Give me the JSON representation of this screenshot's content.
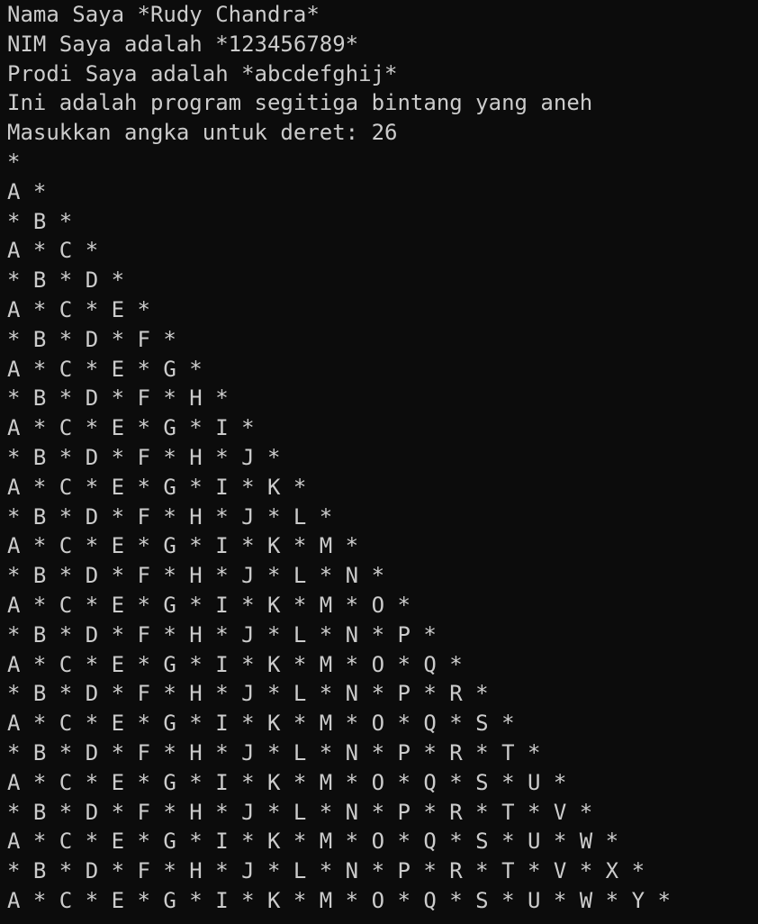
{
  "terminal": {
    "intro": [
      "Nama Saya *Rudy Chandra*",
      "NIM Saya adalah *123456789*",
      "Prodi Saya adalah *abcdefghij*",
      "Ini adalah program segitiga bintang yang aneh",
      "Masukkan angka untuk deret: 26"
    ],
    "triangle": [
      "*",
      "A *",
      "* B *",
      "A * C *",
      "* B * D *",
      "A * C * E *",
      "* B * D * F *",
      "A * C * E * G *",
      "* B * D * F * H *",
      "A * C * E * G * I *",
      "* B * D * F * H * J *",
      "A * C * E * G * I * K *",
      "* B * D * F * H * J * L *",
      "A * C * E * G * I * K * M *",
      "* B * D * F * H * J * L * N *",
      "A * C * E * G * I * K * M * O *",
      "* B * D * F * H * J * L * N * P *",
      "A * C * E * G * I * K * M * O * Q *",
      "* B * D * F * H * J * L * N * P * R *",
      "A * C * E * G * I * K * M * O * Q * S *",
      "* B * D * F * H * J * L * N * P * R * T *",
      "A * C * E * G * I * K * M * O * Q * S * U *",
      "* B * D * F * H * J * L * N * P * R * T * V *",
      "A * C * E * G * I * K * M * O * Q * S * U * W *",
      "* B * D * F * H * J * L * N * P * R * T * V * X *",
      "A * C * E * G * I * K * M * O * Q * S * U * W * Y *"
    ]
  }
}
